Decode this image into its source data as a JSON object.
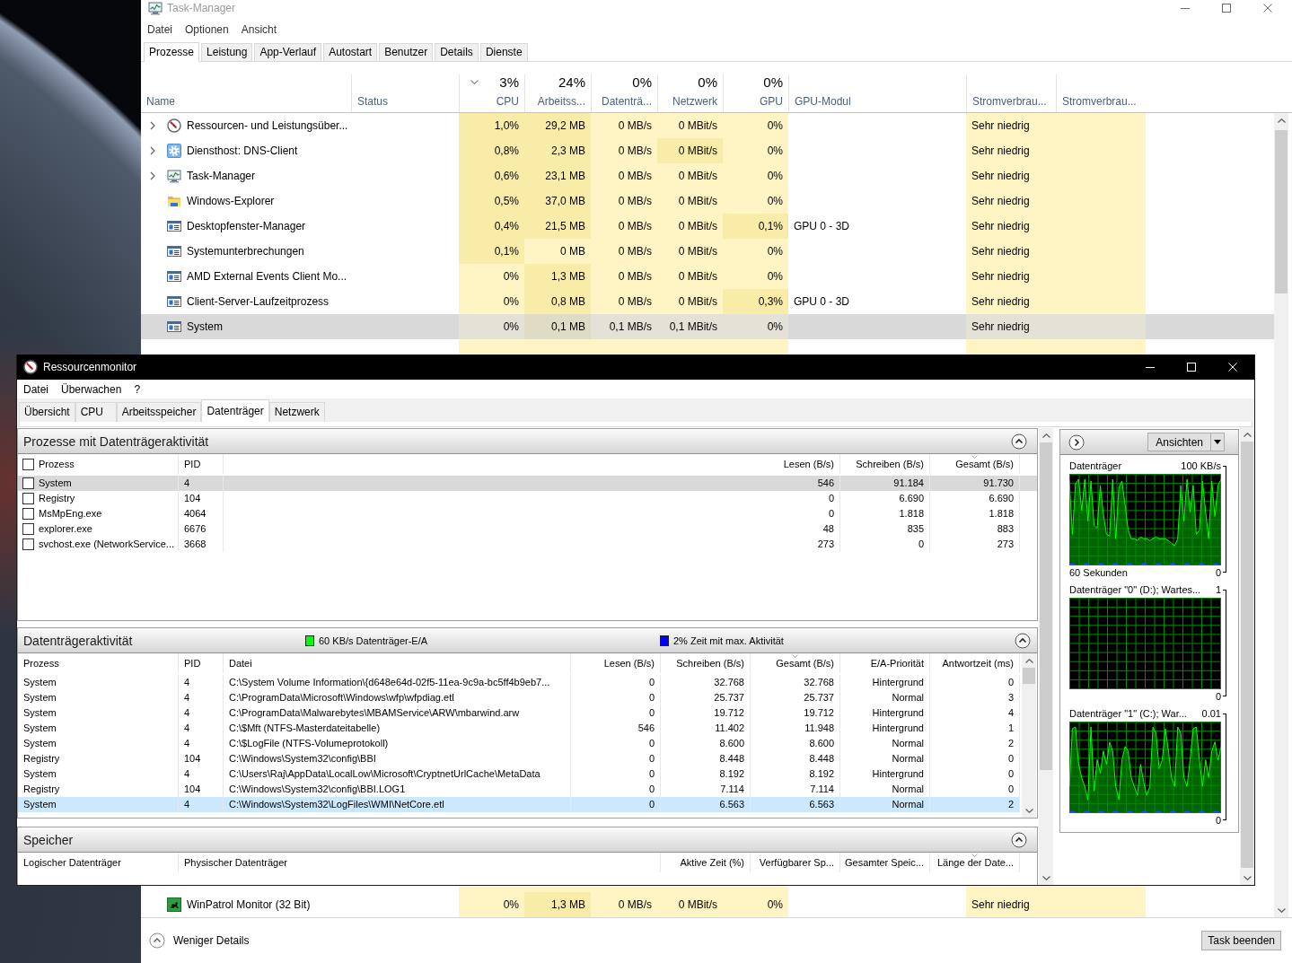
{
  "task_manager": {
    "title": "Task-Manager",
    "menu": [
      "Datei",
      "Optionen",
      "Ansicht"
    ],
    "tabs": [
      {
        "label": "Prozesse",
        "selected": true
      },
      {
        "label": "Leistung",
        "selected": false
      },
      {
        "label": "App-Verlauf",
        "selected": false
      },
      {
        "label": "Autostart",
        "selected": false
      },
      {
        "label": "Benutzer",
        "selected": false
      },
      {
        "label": "Details",
        "selected": false
      },
      {
        "label": "Dienste",
        "selected": false
      }
    ],
    "columns": [
      {
        "label": "Name",
        "sorted": false
      },
      {
        "label": "Status",
        "sorted": false
      },
      {
        "label": "CPU",
        "total": "3%",
        "sorted": true
      },
      {
        "label": "Arbeitss...",
        "total": "24%",
        "sorted": false
      },
      {
        "label": "Datenträ...",
        "total": "0%",
        "sorted": false
      },
      {
        "label": "Netzwerk",
        "total": "0%",
        "sorted": false
      },
      {
        "label": "GPU",
        "total": "0%",
        "sorted": false
      },
      {
        "label": "GPU-Modul",
        "sorted": false
      },
      {
        "label": "Stromverbrau...",
        "sorted": false
      },
      {
        "label": "Stromverbrau...",
        "sorted": false
      }
    ],
    "rows": [
      {
        "name": "Ressourcen- und Leistungsüber...",
        "kind": "gauge",
        "expandable": true,
        "selected": false,
        "values": [
          {
            "text": "1,0%",
            "hot": true
          },
          {
            "text": "29,2 MB",
            "hot": true
          },
          {
            "text": "0 MB/s",
            "hot": false
          },
          {
            "text": "0 MBit/s",
            "hot": false
          },
          {
            "text": "0%",
            "hot": false
          }
        ],
        "power": "Sehr niedrig"
      },
      {
        "name": "Diensthost: DNS-Client",
        "kind": "gear",
        "expandable": true,
        "selected": false,
        "values": [
          {
            "text": "0,8%",
            "hot": true
          },
          {
            "text": "2,3 MB",
            "hot": true
          },
          {
            "text": "0 MB/s",
            "hot": false
          },
          {
            "text": "0 MBit/s",
            "hot": true
          },
          {
            "text": "0%",
            "hot": false
          }
        ],
        "power": "Sehr niedrig"
      },
      {
        "name": "Task-Manager",
        "kind": "monitor",
        "expandable": true,
        "selected": false,
        "values": [
          {
            "text": "0,6%",
            "hot": true
          },
          {
            "text": "23,1 MB",
            "hot": true
          },
          {
            "text": "0 MB/s",
            "hot": false
          },
          {
            "text": "0 MBit/s",
            "hot": false
          },
          {
            "text": "0%",
            "hot": false
          }
        ],
        "power": "Sehr niedrig"
      },
      {
        "name": "Windows-Explorer",
        "kind": "folder",
        "expandable": false,
        "selected": false,
        "values": [
          {
            "text": "0,5%",
            "hot": true
          },
          {
            "text": "37,0 MB",
            "hot": true
          },
          {
            "text": "0 MB/s",
            "hot": false
          },
          {
            "text": "0 MBit/s",
            "hot": false
          },
          {
            "text": "0%",
            "hot": false
          }
        ],
        "power": "Sehr niedrig"
      },
      {
        "name": "Desktopfenster-Manager",
        "kind": "window",
        "expandable": false,
        "selected": false,
        "values": [
          {
            "text": "0,4%",
            "hot": true
          },
          {
            "text": "21,5 MB",
            "hot": true
          },
          {
            "text": "0 MB/s",
            "hot": false
          },
          {
            "text": "0 MBit/s",
            "hot": false
          },
          {
            "text": "0,1%",
            "hot": true
          }
        ],
        "gpu_engine": "GPU 0 - 3D",
        "power": "Sehr niedrig"
      },
      {
        "name": "Systemunterbrechungen",
        "kind": "window",
        "expandable": false,
        "selected": false,
        "values": [
          {
            "text": "0,1%",
            "hot": true
          },
          {
            "text": "0 MB",
            "hot": false
          },
          {
            "text": "0 MB/s",
            "hot": false
          },
          {
            "text": "0 MBit/s",
            "hot": false
          },
          {
            "text": "0%",
            "hot": false
          }
        ],
        "power": "Sehr niedrig"
      },
      {
        "name": "AMD External Events Client Mo...",
        "kind": "window",
        "expandable": false,
        "selected": false,
        "values": [
          {
            "text": "0%",
            "hot": false
          },
          {
            "text": "1,3 MB",
            "hot": true
          },
          {
            "text": "0 MB/s",
            "hot": false
          },
          {
            "text": "0 MBit/s",
            "hot": false
          },
          {
            "text": "0%",
            "hot": false
          }
        ],
        "power": "Sehr niedrig"
      },
      {
        "name": "Client-Server-Laufzeitprozess",
        "kind": "window",
        "expandable": false,
        "selected": false,
        "values": [
          {
            "text": "0%",
            "hot": false
          },
          {
            "text": "0,8 MB",
            "hot": true
          },
          {
            "text": "0 MB/s",
            "hot": false
          },
          {
            "text": "0 MBit/s",
            "hot": false
          },
          {
            "text": "0,3%",
            "hot": true
          }
        ],
        "gpu_engine": "GPU 0 - 3D",
        "power": "Sehr niedrig"
      },
      {
        "name": "System",
        "kind": "window",
        "expandable": false,
        "selected": true,
        "values": [
          {
            "text": "0%",
            "hot": false
          },
          {
            "text": "0,1 MB",
            "hot": true
          },
          {
            "text": "0,1 MB/s",
            "hot": false
          },
          {
            "text": "0,1 MBit/s",
            "hot": false
          },
          {
            "text": "0%",
            "hot": false
          }
        ],
        "power": "Sehr niedrig"
      }
    ],
    "rows_below": [
      {
        "name": "WinPatrol Monitor (32 Bit)",
        "kind": "tile",
        "expandable": false,
        "selected": false,
        "values": [
          {
            "text": "0%",
            "hot": false
          },
          {
            "text": "1,3 MB",
            "hot": true
          },
          {
            "text": "0 MB/s",
            "hot": false
          },
          {
            "text": "0 MBit/s",
            "hot": false
          },
          {
            "text": "0%",
            "hot": false
          }
        ],
        "power": "Sehr niedrig"
      }
    ],
    "fewer_details": "Weniger Details",
    "end_task": "Task beenden"
  },
  "resource_monitor": {
    "title": "Ressourcenmonitor",
    "menu": [
      "Datei",
      "Überwachen",
      "?"
    ],
    "tabs": [
      {
        "label": "Übersicht",
        "selected": false
      },
      {
        "label": "CPU",
        "selected": false
      },
      {
        "label": "Arbeitsspeicher",
        "selected": false
      },
      {
        "label": "Datenträger",
        "selected": true
      },
      {
        "label": "Netzwerk",
        "selected": false
      }
    ],
    "disk_processes": {
      "title": "Prozesse mit Datenträgeraktivität",
      "expanded": true,
      "all_checked": false,
      "columns": [
        {
          "label": "Prozess",
          "sorted": false
        },
        {
          "label": "PID",
          "sorted": false
        },
        {
          "label": "Lesen (B/s)",
          "sorted": false
        },
        {
          "label": "Schreiben (B/s)",
          "sorted": false
        },
        {
          "label": "Gesamt (B/s)",
          "sorted": true
        }
      ],
      "rows": [
        {
          "cells": [
            "System",
            "4",
            "546",
            "91.184",
            "91.730"
          ],
          "checked": false,
          "selected": true
        },
        {
          "cells": [
            "Registry",
            "104",
            "0",
            "6.690",
            "6.690"
          ],
          "checked": false,
          "selected": false
        },
        {
          "cells": [
            "MsMpEng.exe",
            "4064",
            "0",
            "1.818",
            "1.818"
          ],
          "checked": false,
          "selected": false
        },
        {
          "cells": [
            "explorer.exe",
            "6676",
            "48",
            "835",
            "883"
          ],
          "checked": false,
          "selected": false
        },
        {
          "cells": [
            "svchost.exe (NetworkService...",
            "3668",
            "273",
            "0",
            "273"
          ],
          "checked": false,
          "selected": false
        }
      ]
    },
    "disk_activity": {
      "title": "Datenträgeraktivität",
      "expanded": true,
      "legend": [
        {
          "text": "60 KB/s Datenträger-E/A",
          "color": "#00ff00"
        },
        {
          "text": "2% Zeit mit max. Aktivität",
          "color": "#0000ff"
        }
      ],
      "columns": [
        {
          "label": "Prozess",
          "sorted": false
        },
        {
          "label": "PID",
          "sorted": false
        },
        {
          "label": "Datei",
          "sorted": false
        },
        {
          "label": "Lesen (B/s)",
          "sorted": false
        },
        {
          "label": "Schreiben (B/s)",
          "sorted": false
        },
        {
          "label": "Gesamt (B/s)",
          "sorted": true
        },
        {
          "label": "E/A-Priorität",
          "sorted": false
        },
        {
          "label": "Antwortzeit (ms)",
          "sorted": false
        }
      ],
      "rows": [
        {
          "cells": [
            "System",
            "4",
            "C:\\System Volume Information\\{d648e64d-02f5-11ea-9c9a-bc5ff4b9eb7...",
            "0",
            "32.768",
            "32.768",
            "Hintergrund",
            "0"
          ],
          "selected": false
        },
        {
          "cells": [
            "System",
            "4",
            "C:\\ProgramData\\Microsoft\\Windows\\wfp\\wfpdiag.etl",
            "0",
            "25.737",
            "25.737",
            "Normal",
            "3"
          ],
          "selected": false
        },
        {
          "cells": [
            "System",
            "4",
            "C:\\ProgramData\\Malwarebytes\\MBAMService\\ARW\\mbarwind.arw",
            "0",
            "19.712",
            "19.712",
            "Hintergrund",
            "4"
          ],
          "selected": false
        },
        {
          "cells": [
            "System",
            "4",
            "C:\\$Mft (NTFS-Masterdateitabelle)",
            "546",
            "11.402",
            "11.948",
            "Hintergrund",
            "1"
          ],
          "selected": false
        },
        {
          "cells": [
            "System",
            "4",
            "C:\\$LogFile (NTFS-Volumeprotokoll)",
            "0",
            "8.600",
            "8.600",
            "Normal",
            "2"
          ],
          "selected": false
        },
        {
          "cells": [
            "Registry",
            "104",
            "C:\\Windows\\System32\\config\\BBI",
            "0",
            "8.448",
            "8.448",
            "Normal",
            "0"
          ],
          "selected": false
        },
        {
          "cells": [
            "System",
            "4",
            "C:\\Users\\Raj\\AppData\\LocalLow\\Microsoft\\CryptnetUrlCache\\MetaData",
            "0",
            "8.192",
            "8.192",
            "Hintergrund",
            "0"
          ],
          "selected": false
        },
        {
          "cells": [
            "Registry",
            "104",
            "C:\\Windows\\System32\\config\\BBI.LOG1",
            "0",
            "7.114",
            "7.114",
            "Normal",
            "0"
          ],
          "selected": false
        },
        {
          "cells": [
            "System",
            "4",
            "C:\\Windows\\System32\\LogFiles\\WMI\\NetCore.etl",
            "0",
            "6.563",
            "6.563",
            "Normal",
            "2"
          ],
          "selected": true
        }
      ]
    },
    "storage": {
      "title": "Speicher",
      "expanded": true,
      "columns": [
        {
          "label": "Logischer Datenträger",
          "sorted": false
        },
        {
          "label": "Physischer Datenträger",
          "sorted": false
        },
        {
          "label": "Aktive Zeit (%)",
          "sorted": false
        },
        {
          "label": "Verfügbarer Sp...",
          "sorted": false
        },
        {
          "label": "Gesamter Speic...",
          "sorted": false
        },
        {
          "label": "Länge der Date...",
          "sorted": true
        }
      ]
    },
    "views_button": "Ansichten",
    "graphs": [
      {
        "title": "Datenträger",
        "scale_max": "100 KB/s",
        "time_span": "60 Sekunden",
        "scale_min": "0",
        "kind": "active"
      },
      {
        "title": "Datenträger \"0\" (D:); Wartes...",
        "scale_max": "1",
        "scale_min": "0",
        "kind": "idle"
      },
      {
        "title": "Datenträger \"1\" (C:); War...",
        "scale_max": "0.01",
        "scale_min": "0",
        "kind": "active"
      }
    ]
  }
}
